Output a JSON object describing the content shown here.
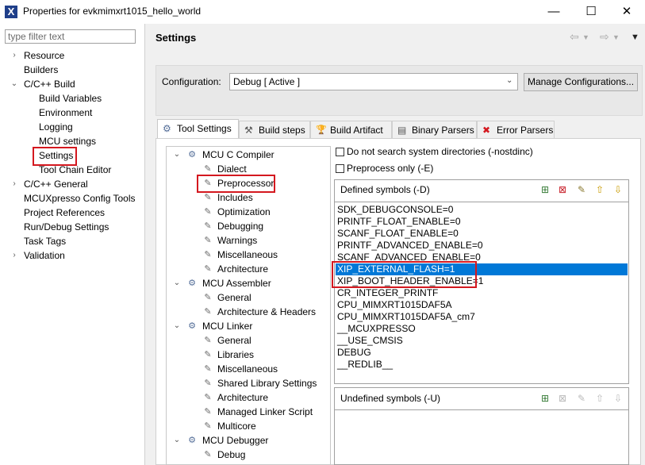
{
  "window": {
    "title": "Properties for evkmimxrt1015_hello_world",
    "minimize": "—",
    "maximize": "☐",
    "close": "✕"
  },
  "filter": {
    "placeholder": "type filter text"
  },
  "nav_tree": [
    {
      "label": "Resource",
      "expander": "›"
    },
    {
      "label": "Builders",
      "expander": ""
    },
    {
      "label": "C/C++ Build",
      "expander": "⌄"
    },
    {
      "label": "Build Variables",
      "expander": ""
    },
    {
      "label": "Environment",
      "expander": ""
    },
    {
      "label": "Logging",
      "expander": ""
    },
    {
      "label": "MCU settings",
      "expander": ""
    },
    {
      "label": "Settings",
      "expander": "",
      "selected": true
    },
    {
      "label": "Tool Chain Editor",
      "expander": ""
    },
    {
      "label": "C/C++ General",
      "expander": "›"
    },
    {
      "label": "MCUXpresso Config Tools",
      "expander": ""
    },
    {
      "label": "Project References",
      "expander": ""
    },
    {
      "label": "Run/Debug Settings",
      "expander": ""
    },
    {
      "label": "Task Tags",
      "expander": ""
    },
    {
      "label": "Validation",
      "expander": "›"
    }
  ],
  "header": {
    "title": "Settings"
  },
  "configuration": {
    "label": "Configuration:",
    "value": "Debug  [ Active ]",
    "manage_button": "Manage Configurations..."
  },
  "tabs": [
    {
      "label": "Tool Settings",
      "icon": "⚙"
    },
    {
      "label": "Build steps",
      "icon": "⚒"
    },
    {
      "label": "Build Artifact",
      "icon": "🏆"
    },
    {
      "label": "Binary Parsers",
      "icon": "▤"
    },
    {
      "label": "Error Parsers",
      "icon": "✖"
    }
  ],
  "tool_tree": [
    {
      "label": "MCU C Compiler",
      "level": 0
    },
    {
      "label": "Dialect",
      "level": 1
    },
    {
      "label": "Preprocessor",
      "level": 1,
      "highlighted": true
    },
    {
      "label": "Includes",
      "level": 1
    },
    {
      "label": "Optimization",
      "level": 1
    },
    {
      "label": "Debugging",
      "level": 1
    },
    {
      "label": "Warnings",
      "level": 1
    },
    {
      "label": "Miscellaneous",
      "level": 1
    },
    {
      "label": "Architecture",
      "level": 1
    },
    {
      "label": "MCU Assembler",
      "level": 0
    },
    {
      "label": "General",
      "level": 1
    },
    {
      "label": "Architecture & Headers",
      "level": 1
    },
    {
      "label": "MCU Linker",
      "level": 0
    },
    {
      "label": "General",
      "level": 1
    },
    {
      "label": "Libraries",
      "level": 1
    },
    {
      "label": "Miscellaneous",
      "level": 1
    },
    {
      "label": "Shared Library Settings",
      "level": 1
    },
    {
      "label": "Architecture",
      "level": 1
    },
    {
      "label": "Managed Linker Script",
      "level": 1
    },
    {
      "label": "Multicore",
      "level": 1
    },
    {
      "label": "MCU Debugger",
      "level": 0
    },
    {
      "label": "Debug",
      "level": 1
    }
  ],
  "options": {
    "no_sys_dirs": "Do not search system directories (-nostdinc)",
    "preprocess_only": "Preprocess only (-E)"
  },
  "defined_symbols": {
    "title": "Defined symbols (-D)",
    "items": [
      "SDK_DEBUGCONSOLE=0",
      "PRINTF_FLOAT_ENABLE=0",
      "SCANF_FLOAT_ENABLE=0",
      "PRINTF_ADVANCED_ENABLE=0",
      "SCANF_ADVANCED_ENABLE=0",
      "XIP_EXTERNAL_FLASH=1",
      "XIP_BOOT_HEADER_ENABLE=1",
      "CR_INTEGER_PRINTF",
      "CPU_MIMXRT1015DAF5A",
      "CPU_MIMXRT1015DAF5A_cm7",
      "__MCUXPRESSO",
      "__USE_CMSIS",
      "DEBUG",
      "__REDLIB__"
    ],
    "selected_index": 5
  },
  "undefined_symbols": {
    "title": "Undefined symbols (-U)"
  },
  "colors": {
    "selection": "#0078d7",
    "highlight_box": "#d4181f"
  }
}
